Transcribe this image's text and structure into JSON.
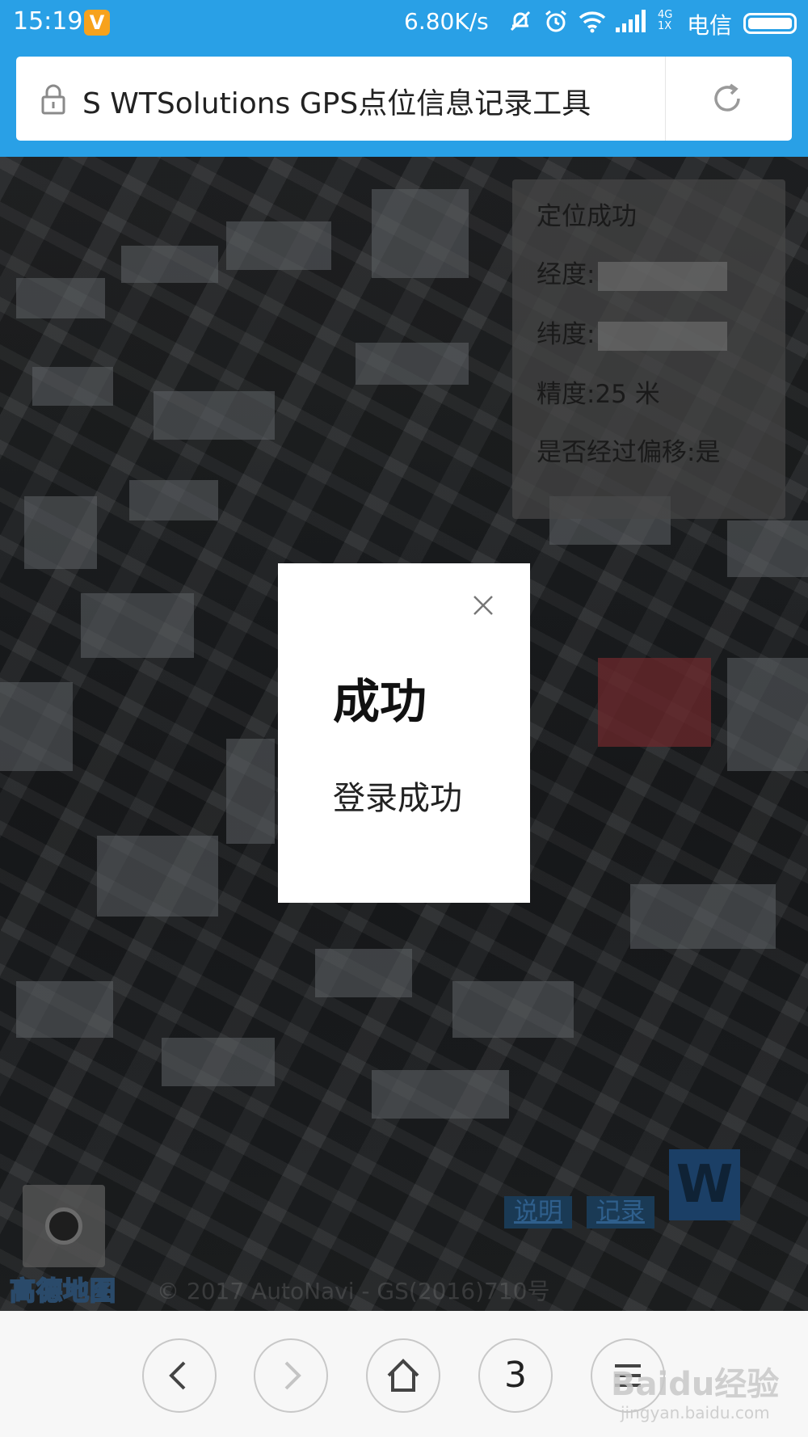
{
  "status_bar": {
    "time": "15:19",
    "app_badge": "V",
    "net_speed": "6.80K/s",
    "signal_4g": "4G",
    "signal_1x": "1X",
    "carrier": "电信"
  },
  "browser": {
    "url_title": "S WTSolutions GPS点位信息记录工具"
  },
  "info_panel": {
    "status": "定位成功",
    "longitude_label": "经度:",
    "latitude_label": "纬度:",
    "accuracy_text": "精度:25 米",
    "offset_text": "是否经过偏移:是"
  },
  "map": {
    "btn_help": "说明",
    "btn_record": "记录",
    "w_logo": "W",
    "provider_logo": "高德地图",
    "copyright": "© 2017 AutoNavi - GS(2016)710号"
  },
  "modal": {
    "title": "成功",
    "message": "登录成功"
  },
  "nav": {
    "tab_count": "3"
  },
  "watermark": {
    "main": "Baidu经验",
    "sub": "jingyan.baidu.com"
  },
  "colors": {
    "status_bar": "#29a0e6",
    "modal_bg": "#ffffff",
    "nav_bg": "#f7f7f7"
  }
}
